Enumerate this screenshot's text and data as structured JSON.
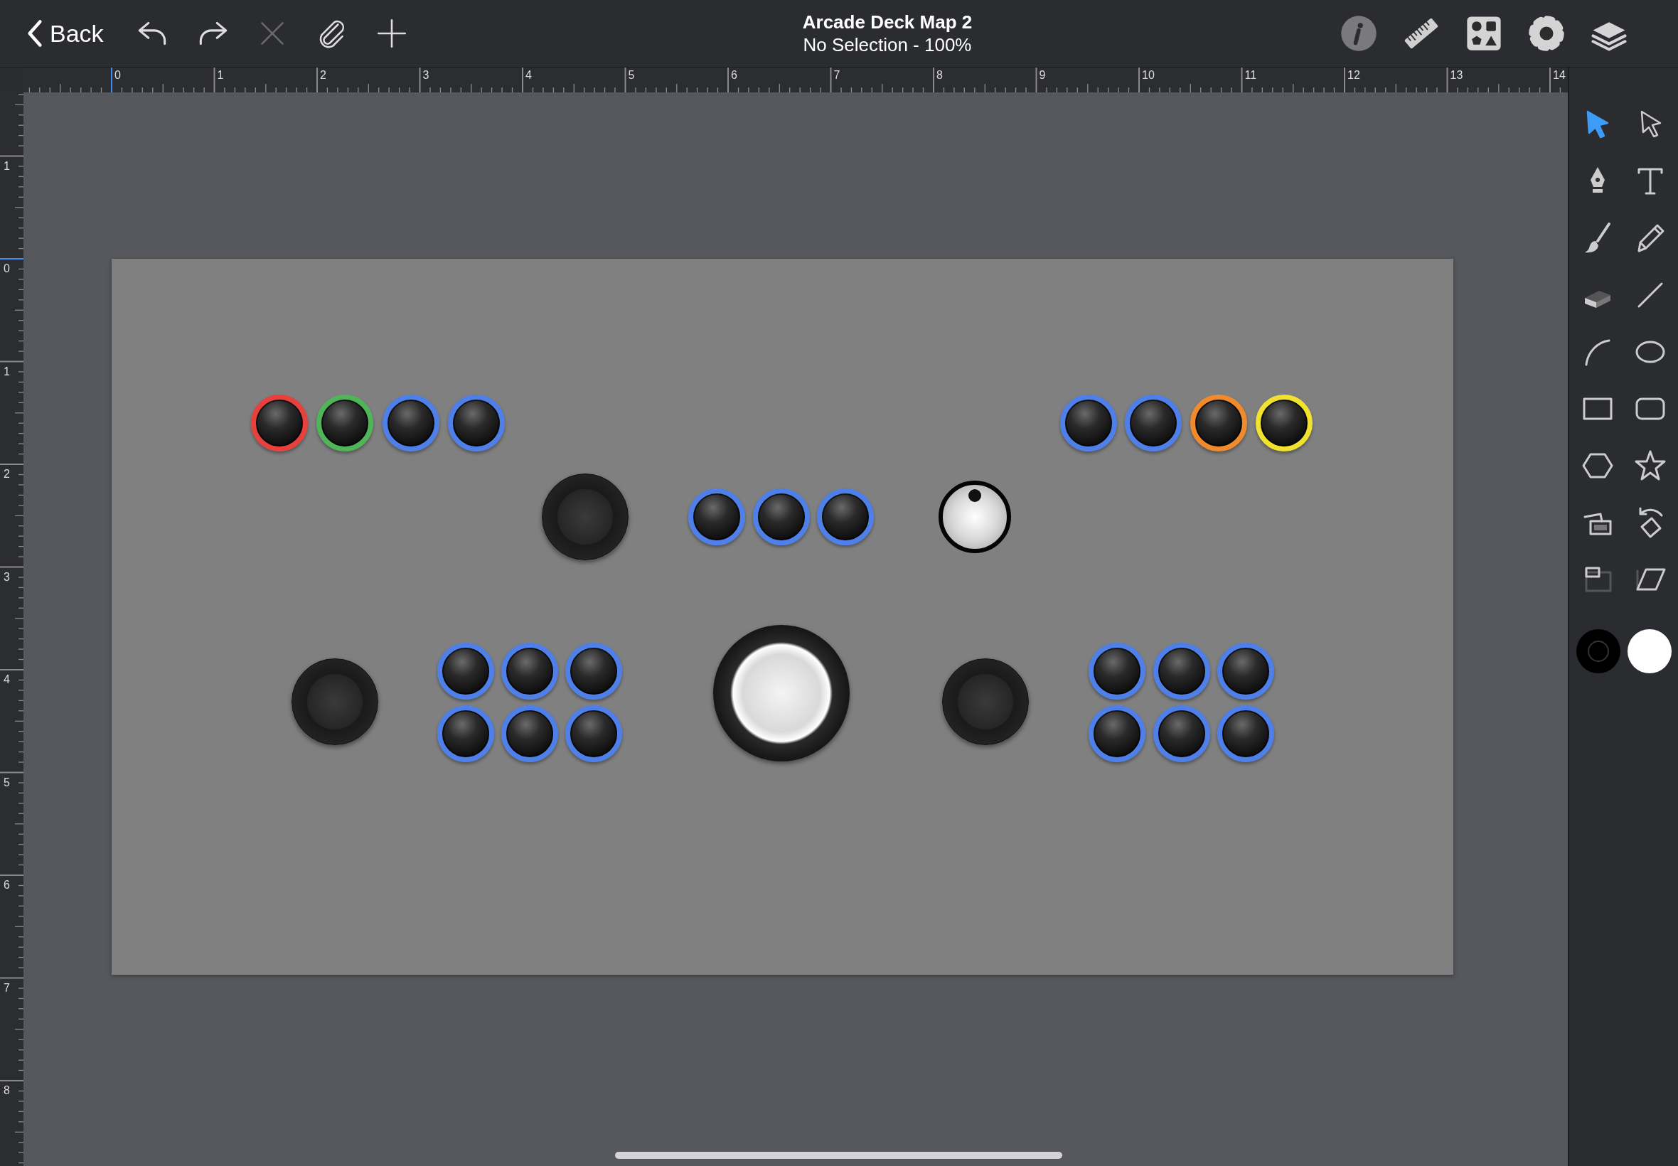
{
  "toolbar": {
    "back": {
      "label": "Back"
    },
    "actions": [
      {
        "kind": "undo",
        "disabled": false
      },
      {
        "kind": "redo",
        "disabled": false
      },
      {
        "kind": "delete",
        "disabled": true
      },
      {
        "kind": "attach",
        "disabled": false
      },
      {
        "kind": "add",
        "disabled": false
      }
    ],
    "title": "Arcade Deck Map 2",
    "subtitle": "No Selection - 100%",
    "tools": [
      {
        "kind": "info"
      },
      {
        "kind": "ruler"
      },
      {
        "kind": "shapes"
      },
      {
        "kind": "settings"
      },
      {
        "kind": "layers"
      }
    ]
  },
  "rulers": {
    "horizontal": [
      "0",
      "1",
      "2",
      "3",
      "4",
      "5",
      "6",
      "7",
      "8",
      "9",
      "10",
      "11",
      "12",
      "13",
      "14"
    ],
    "vertical": [
      "1",
      "0",
      "1",
      "2",
      "3",
      "4",
      "5",
      "6",
      "7",
      "8"
    ]
  },
  "canvas": {
    "items": [
      {
        "kind": "button",
        "color": "#e8403c"
      },
      {
        "kind": "button",
        "color": "#4fb558"
      },
      {
        "kind": "button",
        "color": "#4f7fe8"
      },
      {
        "kind": "button",
        "color": "#4f7fe8"
      },
      {
        "kind": "button",
        "color": "#4f7fe8"
      },
      {
        "kind": "button",
        "color": "#4f7fe8"
      },
      {
        "kind": "button",
        "color": "#f08a2c"
      },
      {
        "kind": "button",
        "color": "#f2e230"
      },
      {
        "kind": "joystick"
      },
      {
        "kind": "button",
        "color": "#4f7fe8"
      },
      {
        "kind": "button",
        "color": "#4f7fe8"
      },
      {
        "kind": "button",
        "color": "#4f7fe8"
      },
      {
        "kind": "spinner"
      },
      {
        "kind": "joystick"
      },
      {
        "kind": "button",
        "color": "#4f7fe8"
      },
      {
        "kind": "button",
        "color": "#4f7fe8"
      },
      {
        "kind": "button",
        "color": "#4f7fe8"
      },
      {
        "kind": "button",
        "color": "#4f7fe8"
      },
      {
        "kind": "button",
        "color": "#4f7fe8"
      },
      {
        "kind": "button",
        "color": "#4f7fe8"
      },
      {
        "kind": "trackball"
      },
      {
        "kind": "joystick"
      },
      {
        "kind": "button",
        "color": "#4f7fe8"
      },
      {
        "kind": "button",
        "color": "#4f7fe8"
      },
      {
        "kind": "button",
        "color": "#4f7fe8"
      },
      {
        "kind": "button",
        "color": "#4f7fe8"
      },
      {
        "kind": "button",
        "color": "#4f7fe8"
      },
      {
        "kind": "button",
        "color": "#4f7fe8"
      }
    ]
  },
  "tool_palette": [
    {
      "kind": "select",
      "selected": true
    },
    {
      "kind": "direct-select",
      "selected": false
    },
    {
      "kind": "pen",
      "selected": false
    },
    {
      "kind": "text",
      "selected": false
    },
    {
      "kind": "brush",
      "selected": false
    },
    {
      "kind": "pencil",
      "selected": false
    },
    {
      "kind": "eraser",
      "selected": false
    },
    {
      "kind": "line",
      "selected": false
    },
    {
      "kind": "arc",
      "selected": false
    },
    {
      "kind": "ellipse",
      "selected": false
    },
    {
      "kind": "rectangle",
      "selected": false
    },
    {
      "kind": "rounded-rectangle",
      "selected": false
    },
    {
      "kind": "polygon",
      "selected": false
    },
    {
      "kind": "star",
      "selected": false
    },
    {
      "kind": "image",
      "selected": false
    },
    {
      "kind": "rotate",
      "selected": false
    },
    {
      "kind": "frame",
      "selected": false
    },
    {
      "kind": "skew",
      "selected": false
    }
  ],
  "style_swatches": [
    {
      "kind": "stroke",
      "color": "#000000"
    },
    {
      "kind": "fill",
      "color": "#ffffff"
    }
  ]
}
